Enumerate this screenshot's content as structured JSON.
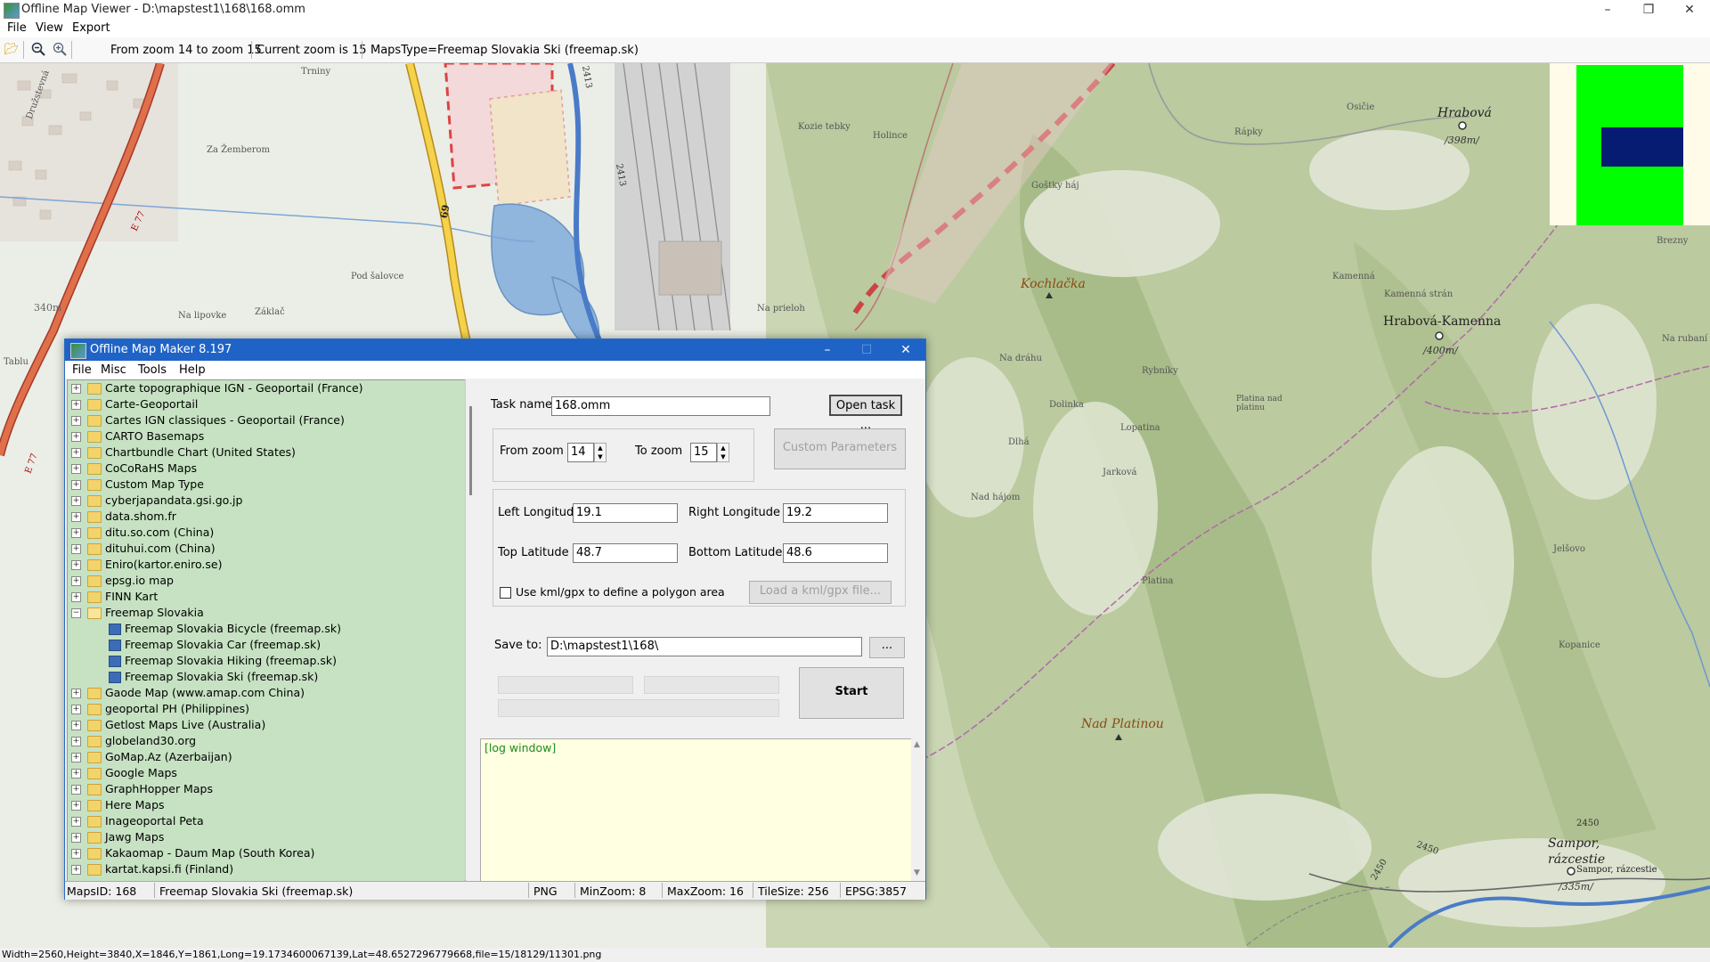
{
  "viewer": {
    "title": "Offline Map Viewer - D:\\mapstest1\\168\\168.omm",
    "menu": [
      "File",
      "View",
      "Export"
    ],
    "toolbar": {
      "zoom_range": "From zoom 14 to zoom 15",
      "current_zoom": "Current zoom is 15",
      "maps_type": "MapsType=Freemap Slovakia Ski (freemap.sk)"
    },
    "status": "Width=2560,Height=3840,X=1846,Y=1861,Long=19.1734600067139,Lat=48.6527296779668,file=15/18129/11301.png"
  },
  "map_labels": {
    "hrabova": "Hrabová",
    "hrabova_alt": "/398m/",
    "hrabova_kamenna": "Hrabová-Kamenna",
    "hk_alt": "/400m/",
    "kochlacka": "Kochlačka",
    "nad_platinou": "Nad Platinou",
    "sampor": "Sampor,",
    "razcestie": "rázcestie",
    "sampor_small": "Sampor, rázcestie",
    "sampor_alt": "/335m/",
    "elev_340": "340m",
    "road_69": "69",
    "road_e77": "E 77",
    "road_e77b": "E 77",
    "road_2413": "2413",
    "road_2413b": "2413",
    "contour_2450a": "2450",
    "contour_2450b": "2450",
    "contour_2450c": "2450",
    "tablu": "Tablu",
    "druzstevna": "Družstevná",
    "za_zemberom": "Za Žemberom",
    "trniny": "Trniny",
    "pod_salovce": "Pod šalovce",
    "na_lipovke": "Na lipovke",
    "zaklac": "Záklač",
    "na_prieloh": "Na prieloh",
    "kozie_tebky": "Kozie tebky",
    "holince": "Holince",
    "gostky_haj": "Goštky háj",
    "osicie": "Osičie",
    "rapky": "Rápky",
    "na_drahu": "Na dráhu",
    "kamenna": "Kamenná",
    "kamenna_stran": "Kamenná strán",
    "rybniky": "Rybníky",
    "dolinka": "Dolinka",
    "lopatina": "Lopatina",
    "platina_nad": "Platina nad platinu",
    "dlha": "Dlhá",
    "jarkova": "Jarková",
    "nad_hajom": "Nad hájom",
    "platina": "Platina",
    "brezny": "Brezny",
    "jelsovo": "Jelšovo",
    "kopanice": "Kopanice",
    "na_rubani": "Na rubaní"
  },
  "dialog": {
    "title": "Offline Map Maker 8.197",
    "menu": [
      "File",
      "Misc",
      "Tools",
      "Help"
    ],
    "tree": [
      "Carte topographique IGN - Geoportail (France)",
      "Carte-Geoportail",
      "Cartes IGN classiques - Geoportail (France)",
      "CARTO Basemaps",
      "Chartbundle Chart (United States)",
      "CoCoRaHS Maps",
      "Custom Map Type",
      "cyberjapandata.gsi.go.jp",
      "data.shom.fr",
      "ditu.so.com (China)",
      "dituhui.com (China)",
      "Eniro(kartor.eniro.se)",
      "epsg.io map",
      "FINN Kart",
      "Freemap Slovakia",
      "Freemap Slovakia Bicycle (freemap.sk)",
      "Freemap Slovakia Car (freemap.sk)",
      "Freemap Slovakia Hiking (freemap.sk)",
      "Freemap Slovakia Ski (freemap.sk)",
      "Gaode Map (www.amap.com China)",
      "geoportal PH (Philippines)",
      "Getlost Maps Live (Australia)",
      "globeland30.org",
      "GoMap.Az (Azerbaijan)",
      "Google Maps",
      "GraphHopper Maps",
      "Here Maps",
      "Inageoportal Peta",
      "Jawg Maps",
      "Kakaomap - Daum Map (South Korea)",
      "kartat.kapsi.fi (Finland)"
    ],
    "task_name_label": "Task name",
    "task_name_value": "168.omm",
    "open_task": "Open task ...",
    "from_zoom_label": "From zoom",
    "from_zoom_value": "14",
    "to_zoom_label": "To zoom",
    "to_zoom_value": "15",
    "custom_params": "Custom Parameters",
    "left_lon_label": "Left Longitude",
    "left_lon_value": "19.1",
    "right_lon_label": "Right Longitude",
    "right_lon_value": "19.2",
    "top_lat_label": "Top Latitude",
    "top_lat_value": "48.7",
    "bottom_lat_label": "Bottom Latitude",
    "bottom_lat_value": "48.6",
    "kml_checkbox": "Use kml/gpx to define a polygon area",
    "load_kml": "Load a kml/gpx file...",
    "save_to_label": "Save to:",
    "save_to_value": "D:\\mapstest1\\168\\",
    "browse": "...",
    "start": "Start",
    "log": "[log window]",
    "status": {
      "maps_id": "MapsID: 168",
      "maps_name": "Freemap Slovakia Ski (freemap.sk)",
      "format": "PNG",
      "min_zoom": "MinZoom: 8",
      "max_zoom": "MaxZoom: 16",
      "tile_size": "TileSize: 256",
      "epsg": "EPSG:3857"
    }
  },
  "colors": {
    "dialog_title": "#1f63c6",
    "tree_bg": "#c6e2c2",
    "log_bg": "#ffffe2",
    "minimap_green": "#00ff00",
    "minimap_navy": "#061b72"
  }
}
